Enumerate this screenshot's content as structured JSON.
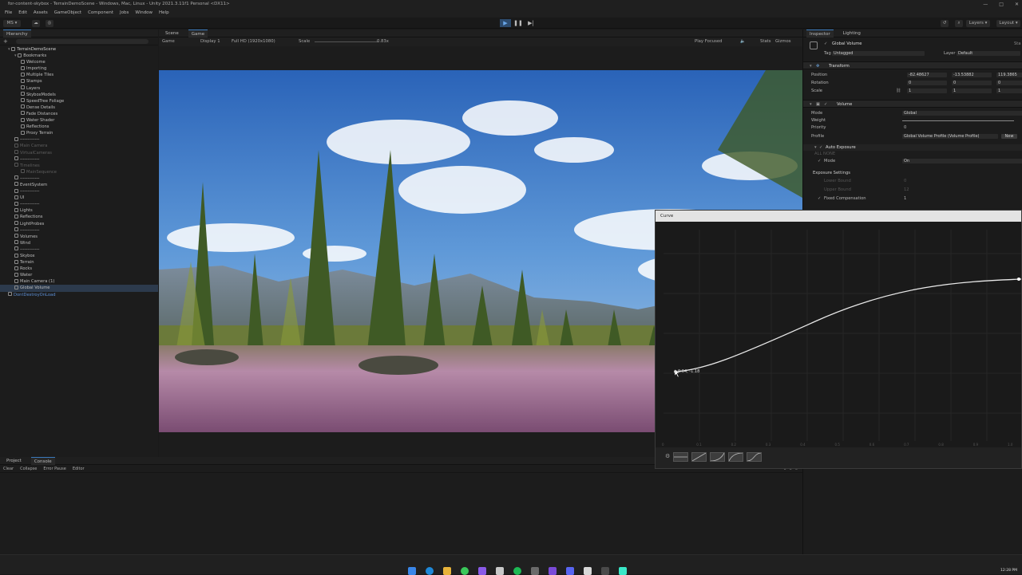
{
  "window": {
    "title": "for-content-skybox - TerrainDemoScene - Windows, Mac, Linux - Unity 2021.3.11f1 Personal <DX11>",
    "controls": [
      "—",
      "□",
      "✕"
    ]
  },
  "menu": [
    "File",
    "Edit",
    "Assets",
    "GameObject",
    "Component",
    "Jobs",
    "Window",
    "Help"
  ],
  "toolbar": {
    "account": "MS",
    "layers": "Layers",
    "layout": "Layout"
  },
  "hierarchy": {
    "tab": "Hierarchy",
    "items": [
      {
        "label": "TerrainDemoScene",
        "type": "root"
      },
      {
        "label": "Bookmarks",
        "type": "normal",
        "indent": 1
      },
      {
        "label": "Welcome",
        "type": "normal",
        "indent": 2
      },
      {
        "label": "Importing",
        "type": "normal",
        "indent": 2
      },
      {
        "label": "Multiple Tiles",
        "type": "normal",
        "indent": 2
      },
      {
        "label": "Stamps",
        "type": "normal",
        "indent": 2
      },
      {
        "label": "Layers",
        "type": "normal",
        "indent": 2
      },
      {
        "label": "SkyboxModels",
        "type": "normal",
        "indent": 2
      },
      {
        "label": "SpeedTree Foliage",
        "type": "normal",
        "indent": 2
      },
      {
        "label": "Dense Details",
        "type": "normal",
        "indent": 2
      },
      {
        "label": "Fade Distances",
        "type": "normal",
        "indent": 2
      },
      {
        "label": "Water Shader",
        "type": "normal",
        "indent": 2
      },
      {
        "label": "Reflections",
        "type": "normal",
        "indent": 2
      },
      {
        "label": "Proxy Terrain",
        "type": "normal",
        "indent": 2
      },
      {
        "label": "-------------",
        "type": "normal",
        "indent": 1
      },
      {
        "label": "Main Camera",
        "type": "dim",
        "indent": 1
      },
      {
        "label": "VirtualCameras",
        "type": "dim",
        "indent": 1
      },
      {
        "label": "-------------",
        "type": "normal",
        "indent": 1
      },
      {
        "label": "Timelines",
        "type": "dim",
        "indent": 1
      },
      {
        "label": "MainSequence",
        "type": "dim",
        "indent": 2
      },
      {
        "label": "-------------",
        "type": "normal",
        "indent": 1
      },
      {
        "label": "EventSystem",
        "type": "normal",
        "indent": 1
      },
      {
        "label": "-------------",
        "type": "normal",
        "indent": 1
      },
      {
        "label": "UI",
        "type": "normal",
        "indent": 1
      },
      {
        "label": "-------------",
        "type": "normal",
        "indent": 1
      },
      {
        "label": "Lights",
        "type": "normal",
        "indent": 1
      },
      {
        "label": "Reflections",
        "type": "normal",
        "indent": 1
      },
      {
        "label": "LightProbes",
        "type": "normal",
        "indent": 1
      },
      {
        "label": "-------------",
        "type": "normal",
        "indent": 1
      },
      {
        "label": "Volumes",
        "type": "normal",
        "indent": 1
      },
      {
        "label": "Wind",
        "type": "normal",
        "indent": 1
      },
      {
        "label": "-------------",
        "type": "normal",
        "indent": 1
      },
      {
        "label": "Skybox",
        "type": "normal",
        "indent": 1
      },
      {
        "label": "Terrain",
        "type": "normal",
        "indent": 1
      },
      {
        "label": "Rocks",
        "type": "normal",
        "indent": 1
      },
      {
        "label": "Water",
        "type": "normal",
        "indent": 1
      },
      {
        "label": "Main Camera (1)",
        "type": "normal",
        "indent": 1
      },
      {
        "label": "Global Volume",
        "type": "sel",
        "indent": 1
      },
      {
        "label": "DontDestroyOnLoad",
        "type": "blue",
        "indent": 0
      }
    ]
  },
  "gameview": {
    "tabs": [
      "Scene",
      "Game"
    ],
    "mode": "Game",
    "display": "Display 1",
    "resolution": "Full HD (1920x1080)",
    "scale_label": "Scale",
    "scale_value": "0.83x",
    "play_focused": "Play Focused",
    "stats": "Stats",
    "gizmos": "Gizmos"
  },
  "bottom": {
    "tabs": [
      "Project",
      "Console"
    ],
    "buttons": [
      "Clear",
      "Collapse",
      "Error Pause",
      "Editor"
    ],
    "counts": [
      "0",
      "0",
      "0"
    ]
  },
  "inspector": {
    "tabs": [
      "Inspector",
      "Lighting"
    ],
    "object_name": "Global Volume",
    "static_label": "Sta",
    "tag_label": "Tag",
    "tag_value": "Untagged",
    "layer_label": "Layer",
    "layer_value": "Default",
    "transform": {
      "title": "Transform",
      "position_label": "Position",
      "rotation_label": "Rotation",
      "scale_label": "Scale",
      "position": [
        "-82.48627",
        "-13.53882",
        "119.3865"
      ],
      "rotation": [
        "0",
        "0",
        "0"
      ],
      "scale": [
        "1",
        "1",
        "1"
      ]
    },
    "volume": {
      "title": "Volume",
      "mode_label": "Mode",
      "mode_value": "Global",
      "weight_label": "Weight",
      "weight_value": 1.0,
      "priority_label": "Priority",
      "priority_value": "0",
      "profile_label": "Profile",
      "profile_value": "Global Volume Profile (Volume Profile)",
      "new_button": "New"
    },
    "auto_exposure": {
      "title": "Auto Exposure",
      "all_none": "ALL  NONE",
      "mode_label": "Mode",
      "mode_value": "On",
      "exposure_settings": "Exposure Settings",
      "lower_bound_label": "Lower Bound",
      "lower_bound_value": "0",
      "upper_bound_label": "Upper Bound",
      "upper_bound_value": "12",
      "fixed_comp_label": "Fixed Compensation",
      "fixed_comp_value": "1"
    }
  },
  "curve": {
    "title": "Curve",
    "key_label": "0.04, -1.18",
    "x_ticks": [
      "0",
      "0.1",
      "0.2",
      "0.3",
      "0.4",
      "0.5",
      "0.6",
      "0.7",
      "0.8",
      "0.9",
      "1.0"
    ]
  },
  "taskbar": {
    "time": "12:28 PM",
    "date": "..."
  }
}
